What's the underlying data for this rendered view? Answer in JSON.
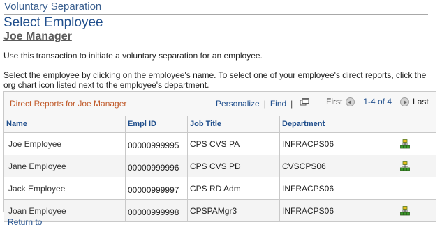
{
  "header": {
    "breadcrumb_title": "Voluntary Separation",
    "page_title": "Select Employee",
    "manager_name": "Joe Manager"
  },
  "instructions": {
    "line1": "Use this transaction to initiate a voluntary separation for an employee.",
    "line2": "Select the employee by clicking on the employee's name. To select one of your employee's direct reports, click the org chart icon listed next to the employee's department."
  },
  "grid": {
    "caption": "Direct Reports for Joe Manager",
    "personalize_label": "Personalize",
    "separator": "|",
    "find_label": "Find",
    "first_label": "First",
    "range_label": "1-4 of 4",
    "last_label": "Last",
    "columns": [
      "Name",
      "Empl ID",
      "Job Title",
      "Department",
      ""
    ],
    "rows": [
      {
        "name": "Joe Employee",
        "emplid": "00000999995",
        "job_title": "CPS CVS PA",
        "department": "INFRACPS06",
        "has_org_icon": true
      },
      {
        "name": "Jane Employee",
        "emplid": "00000999996",
        "job_title": "CPS CVS PD",
        "department": "CVSCPS06",
        "has_org_icon": true
      },
      {
        "name": "Jack Employee",
        "emplid": "00000999997",
        "job_title": "CPS RD Adm",
        "department": "INFRACPS06",
        "has_org_icon": false
      },
      {
        "name": "Joan Employee",
        "emplid": "00000999998",
        "job_title": "CPSPAMgr3",
        "department": "INFRACPS06",
        "has_org_icon": true
      }
    ]
  },
  "footer": {
    "return_label": "Return to"
  },
  "icons": {
    "view_all": "view-all-icon",
    "prev": "previous-arrow-icon",
    "next": "next-arrow-icon",
    "org_chart": "org-chart-icon"
  },
  "colors": {
    "link": "#1f4e8c",
    "caption": "#c05a2a",
    "org_icon_green": "#3a9a2a",
    "org_icon_yellow": "#e8c020"
  }
}
